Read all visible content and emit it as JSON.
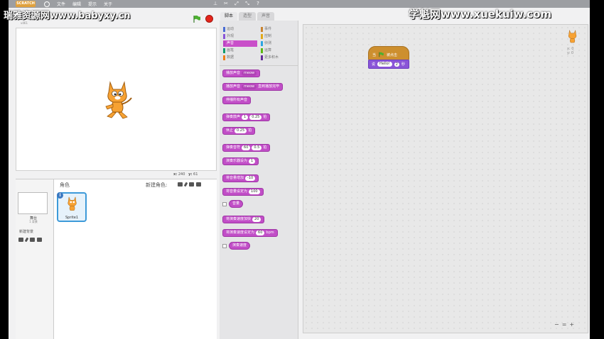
{
  "watermarks": {
    "left": "瑞雅资源网www.babyxy.cn",
    "right": "学魁网www.xuekuiw.com"
  },
  "menubar": {
    "logo": "SCRATCH",
    "items": [
      "文件",
      "编辑",
      "提示",
      "关于"
    ]
  },
  "stage": {
    "version": "v461",
    "mouse_x_label": "x:",
    "mouse_x": "240",
    "mouse_y_label": "y:",
    "mouse_y": "61"
  },
  "sprites": {
    "header": "角色",
    "new_sprite_label": "新建角色:",
    "stage_label": "舞台",
    "stage_sub": "1 背景",
    "new_backdrop_label": "新建背景",
    "sprite_name": "Sprite1",
    "info_glyph": "i"
  },
  "tabs": [
    "脚本",
    "造型",
    "声音"
  ],
  "categories": {
    "left": [
      "运动",
      "外观",
      "声音",
      "画笔",
      "数据"
    ],
    "right": [
      "事件",
      "控制",
      "侦测",
      "运算",
      "更多积木"
    ],
    "left_colors": [
      "#4a6cd4",
      "#8a55d7",
      "#bb42c3",
      "#0e9a6c",
      "#ee7d16"
    ],
    "right_colors": [
      "#c88330",
      "#e1a91a",
      "#2ca5e2",
      "#5cb712",
      "#632d99"
    ]
  },
  "blocks": {
    "play_sound": "播放声音",
    "play_sound_until": "播放声音",
    "until_done": "直到播放完毕",
    "sound_name": "meow",
    "stop_all": "停播所有声音",
    "drum": "弹奏鼓声",
    "drum_val": "1",
    "beats_val": "0.25",
    "beats": "拍",
    "rest": "休止",
    "rest_val": "0.25",
    "note": "弹奏音符",
    "note_val": "60",
    "note_beats": "0.5",
    "instrument": "演奏乐器设为",
    "instrument_val": "1",
    "change_volume": "将音量增加",
    "change_volume_val": "-10",
    "set_volume": "将音量设定为",
    "set_volume_val": "100",
    "volume": "音量",
    "change_tempo": "将演奏速度加快",
    "change_tempo_val": "20",
    "set_tempo": "将演奏速度设定为",
    "set_tempo_val": "60",
    "bpm": "bpm",
    "tempo": "演奏速度"
  },
  "script": {
    "hat_when": "当",
    "hat_clicked": "被点击",
    "say": "说",
    "say_text": "Hello!",
    "say_secs": "2",
    "say_unit": "秒"
  },
  "sprite_info": {
    "x": "x: 0",
    "y": "y: 0"
  },
  "zoom": [
    "−",
    "=",
    "+"
  ]
}
